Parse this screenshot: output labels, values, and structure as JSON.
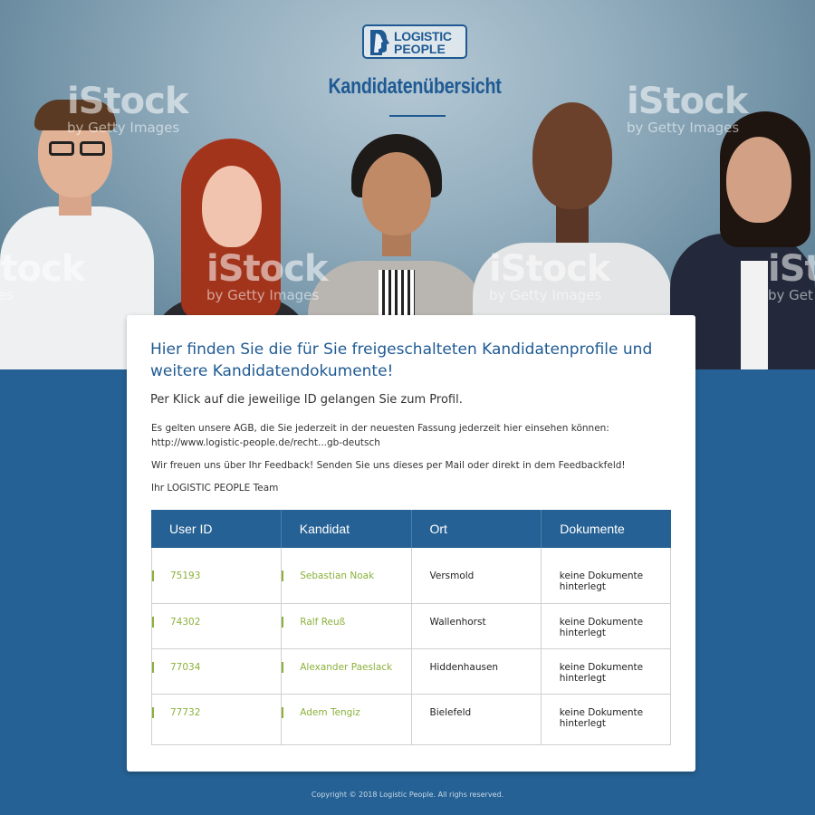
{
  "header": {
    "logo_line1": "LOGISTIC",
    "logo_line2": "PEOPLE",
    "title": "Kandidatenübersicht"
  },
  "watermarks": [
    {
      "big": "iStock",
      "small": "by Getty Images"
    },
    {
      "big": "iStock",
      "small": "by Getty Images"
    },
    {
      "big": "iStock",
      "small": "by Getty Images"
    },
    {
      "big": "iStock",
      "small": "by Getty Images"
    },
    {
      "big": "iStock",
      "small": "by Getty Images"
    },
    {
      "big": "iStock",
      "small": "Images"
    },
    {
      "big": "iSt",
      "small": "by Get"
    }
  ],
  "card": {
    "headline": "Hier finden Sie die für Sie freigeschalteten Kandidatenprofile und weitere Kandidatendokumente!",
    "intro": "Per Klick auf die jeweilige ID gelangen Sie zum Profil.",
    "agb_line1": "Es gelten unsere AGB, die Sie jederzeit in der neuesten Fassung jederzeit hier einsehen können:",
    "agb_line2": "http://www.logistic-people.de/recht...gb-deutsch",
    "feedback": "Wir freuen uns über Ihr Feedback! Senden Sie uns dieses per Mail oder direkt in dem Feedbackfeld!",
    "signature": "Ihr LOGISTIC PEOPLE Team"
  },
  "table": {
    "headers": [
      "User ID",
      "Kandidat",
      "Ort",
      "Dokumente"
    ],
    "rows": [
      {
        "id": "75193",
        "name": "Sebastian Noak",
        "ort": "Versmold",
        "docs": "keine Dokumente hinterlegt"
      },
      {
        "id": "74302",
        "name": "Ralf Reuß",
        "ort": "Wallenhorst",
        "docs": "keine Dokumente hinterlegt"
      },
      {
        "id": "77034",
        "name": "Alexander Paeslack",
        "ort": "Hiddenhausen",
        "docs": "keine Dokumente hinterlegt"
      },
      {
        "id": "77732",
        "name": "Adem Tengiz",
        "ort": "Bielefeld",
        "docs": "keine Dokumente hinterlegt"
      }
    ]
  },
  "footer": {
    "copyright": "Copyright © 2018 Logistic People. All righs reserved."
  },
  "colors": {
    "brand_blue": "#256194",
    "link_green": "#8bb13b"
  }
}
